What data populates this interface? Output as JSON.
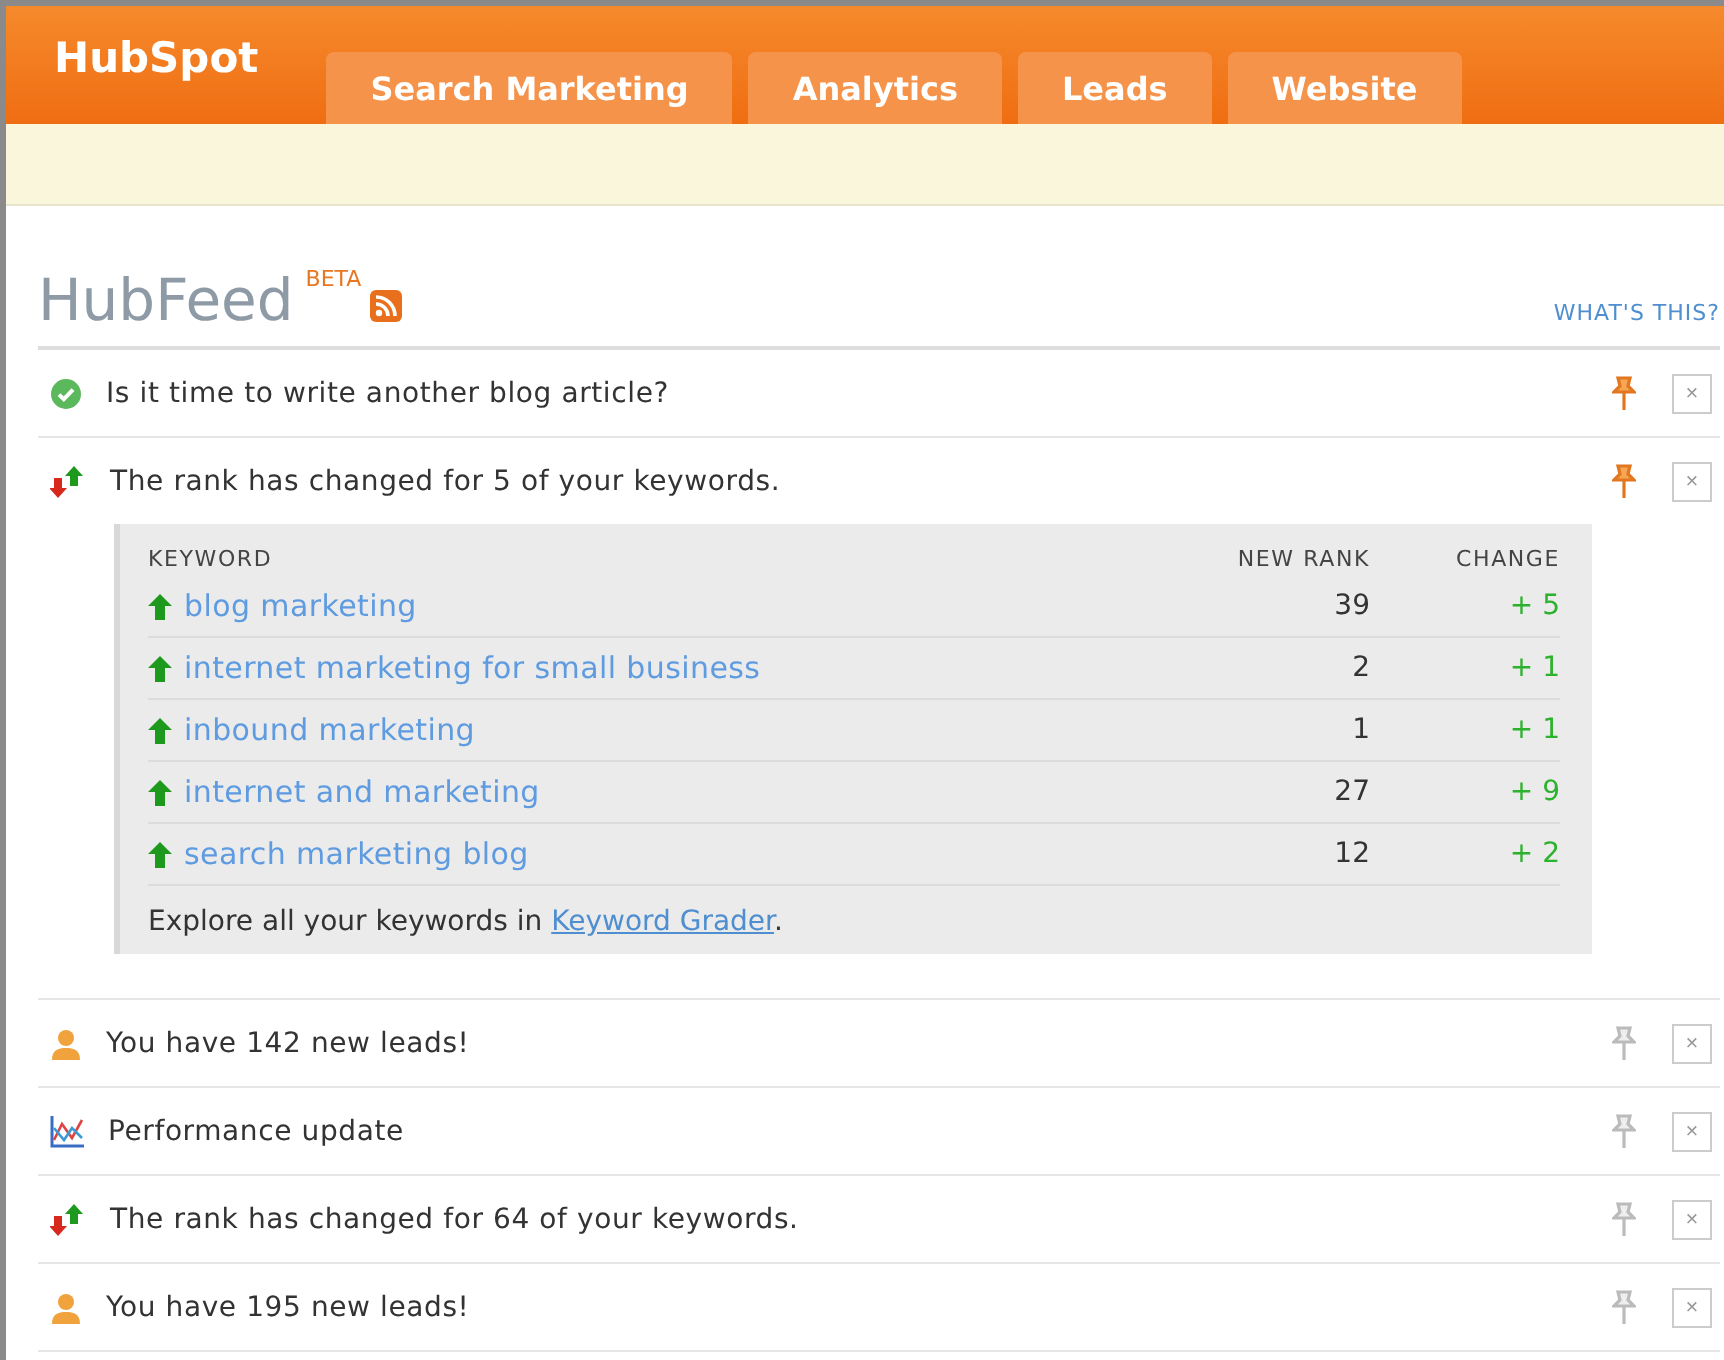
{
  "logo": "HubSpot",
  "tabs": [
    {
      "label": "Search Marketing",
      "selected": false
    },
    {
      "label": "Analytics",
      "selected": false
    },
    {
      "label": "Leads",
      "selected": false
    },
    {
      "label": "Website",
      "selected": false
    }
  ],
  "feed": {
    "title": "HubFeed",
    "badge": "BETA",
    "help_link": "WHAT'S THIS?",
    "items": [
      {
        "kind": "check",
        "text": "Is it time to write another blog article?",
        "pinned": true,
        "close": "×"
      },
      {
        "kind": "rank",
        "text": "The rank has changed for 5 of your keywords.",
        "pinned": true,
        "close": "×",
        "table": {
          "columns": [
            "KEYWORD",
            "NEW RANK",
            "CHANGE"
          ],
          "rows": [
            {
              "keyword": "blog marketing",
              "rank": "39",
              "change": "+ 5"
            },
            {
              "keyword": "internet marketing for small business",
              "rank": "2",
              "change": "+ 1"
            },
            {
              "keyword": "inbound marketing",
              "rank": "1",
              "change": "+ 1"
            },
            {
              "keyword": "internet and marketing",
              "rank": "27",
              "change": "+ 9"
            },
            {
              "keyword": "search marketing blog",
              "rank": "12",
              "change": "+ 2"
            }
          ],
          "footer_before": "Explore all your keywords in ",
          "footer_link": "Keyword Grader",
          "footer_after": "."
        }
      },
      {
        "kind": "leads",
        "text": "You have 142 new leads!",
        "pinned": false,
        "close": "×"
      },
      {
        "kind": "performance",
        "text": "Performance update",
        "pinned": false,
        "close": "×"
      },
      {
        "kind": "rank",
        "text": "The rank has changed for 64 of your keywords.",
        "pinned": false,
        "close": "×"
      },
      {
        "kind": "leads",
        "text": "You have 195 new leads!",
        "pinned": false,
        "close": "×"
      }
    ]
  }
}
